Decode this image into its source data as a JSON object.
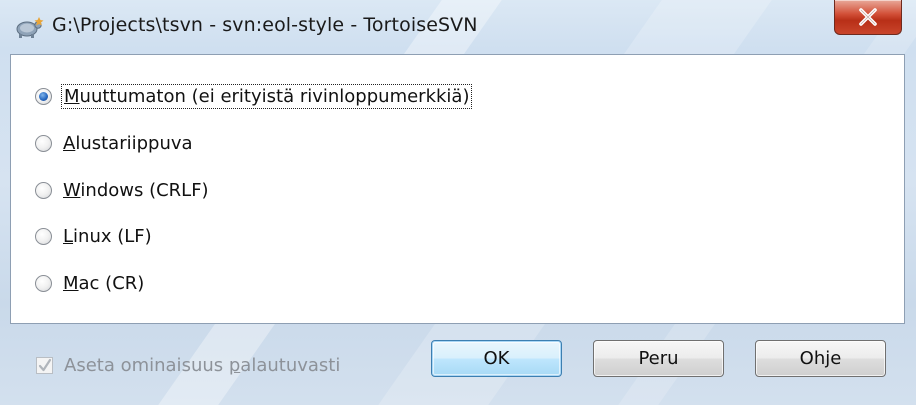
{
  "window": {
    "title": "G:\\Projects\\tsvn - svn:eol-style - TortoiseSVN",
    "app_icon": "tortoisesvn-icon",
    "close_icon": "close-icon"
  },
  "options": [
    {
      "label": "Muuttumaton (ei erityistä rivinloppumerkkiä)",
      "mnemonic": "M",
      "rest": "uuttumaton (ei erityistä rivinloppumerkkiä)",
      "checked": true
    },
    {
      "label": "Alustariippuva",
      "mnemonic": "A",
      "rest": "lustariippuva",
      "checked": false
    },
    {
      "label": "Windows (CRLF)",
      "mnemonic": "W",
      "rest": "indows (CRLF)",
      "checked": false
    },
    {
      "label": "Linux (LF)",
      "mnemonic": "L",
      "rest": "inux (LF)",
      "checked": false
    },
    {
      "label": "Mac (CR)",
      "mnemonic": "M",
      "rest": "ac (CR)",
      "checked": false
    }
  ],
  "recursive": {
    "label": "Aseta ominaisuus palautuvasti",
    "before": "Aseta ominaisuus ",
    "mnemonic": "p",
    "after": "alautuvasti",
    "checked": true,
    "enabled": false
  },
  "buttons": {
    "ok": "OK",
    "cancel": "Peru",
    "help": "Ohje"
  },
  "colors": {
    "close_button": "#c9452b",
    "radio_selected": "#2a6bc2",
    "default_button_border": "#3c7fb1"
  }
}
